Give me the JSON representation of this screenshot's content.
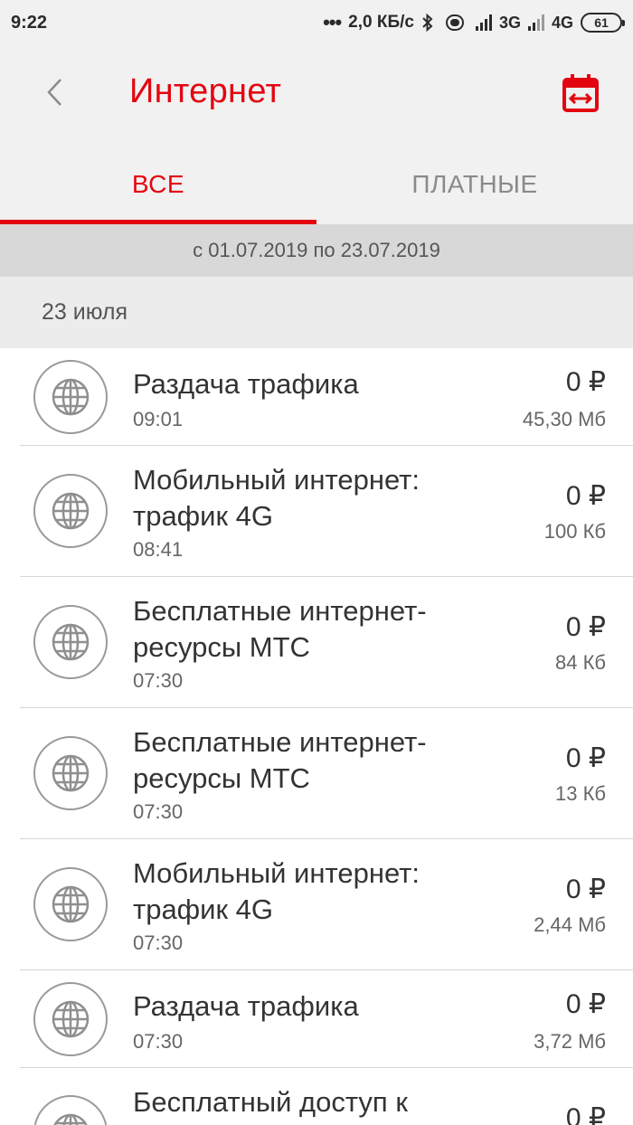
{
  "status_bar": {
    "time": "9:22",
    "speed": "2,0 КБ/с",
    "net1": "3G",
    "net2": "4G",
    "battery": "61",
    "bluetooth_icon": "bluetooth-icon",
    "signal_icon": "signal-bars-icon"
  },
  "header": {
    "title": "Интернет",
    "back_icon": "chevron-left-icon",
    "calendar_icon": "calendar-range-icon"
  },
  "tabs": [
    {
      "label": "ВСЕ",
      "active": true
    },
    {
      "label": "ПЛАТНЫЕ",
      "active": false
    }
  ],
  "period": "с 01.07.2019 по 23.07.2019",
  "date_group": "23 июля",
  "items": [
    {
      "name": "Раздача трафика",
      "time": "09:01",
      "price": "0 ₽",
      "size": "45,30 Мб"
    },
    {
      "name": "Мобильный интернет: трафик 4G",
      "time": "08:41",
      "price": "0 ₽",
      "size": "100 Кб"
    },
    {
      "name": "Бесплатные интернет-ресурсы МТС",
      "time": "07:30",
      "price": "0 ₽",
      "size": "84 Кб"
    },
    {
      "name": "Бесплатные интернет-ресурсы МТС",
      "time": "07:30",
      "price": "0 ₽",
      "size": "13 Кб"
    },
    {
      "name": "Мобильный интернет: трафик 4G",
      "time": "07:30",
      "price": "0 ₽",
      "size": "2,44 Мб"
    },
    {
      "name": "Раздача трафика",
      "time": "07:30",
      "price": "0 ₽",
      "size": "3,72 Мб"
    },
    {
      "name": "Бесплатный доступ к",
      "time": "",
      "price": "0 ₽",
      "size": ""
    }
  ],
  "colors": {
    "accent": "#e30611",
    "background": "#f1f1f1",
    "period_bg": "#d8d8d8"
  }
}
